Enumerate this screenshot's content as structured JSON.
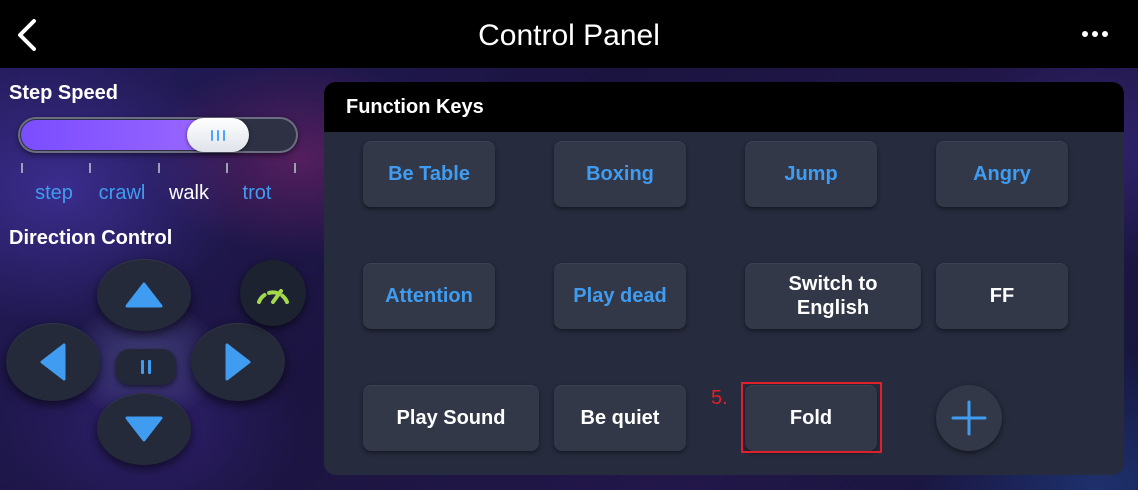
{
  "header": {
    "title": "Control Panel",
    "back_icon": "chevron-left-icon",
    "more_icon": "more-horizontal-icon"
  },
  "step_speed": {
    "label": "Step Speed",
    "options": [
      "step",
      "crawl",
      "walk",
      "trot"
    ],
    "selected": "walk",
    "value_fraction": 0.73
  },
  "direction": {
    "label": "Direction Control",
    "buttons": [
      "up",
      "left",
      "pause",
      "right",
      "down"
    ],
    "gauge_icon": "speedometer-icon"
  },
  "function_keys": {
    "title": "Function Keys",
    "keys": [
      {
        "label": "Be Table",
        "color": "#3f9cf0"
      },
      {
        "label": "Boxing",
        "color": "#3f9cf0"
      },
      {
        "label": "Jump",
        "color": "#3f9cf0"
      },
      {
        "label": "Angry",
        "color": "#3f9cf0"
      },
      {
        "label": "Attention",
        "color": "#3f9cf0"
      },
      {
        "label": "Play dead",
        "color": "#3f9cf0"
      },
      {
        "label": "Switch to English",
        "color": "#ffffff"
      },
      {
        "label": "FF",
        "color": "#ffffff"
      },
      {
        "label": "Play Sound",
        "color": "#ffffff"
      },
      {
        "label": "Be quiet",
        "color": "#ffffff"
      },
      {
        "label": "Fold",
        "color": "#ffffff"
      }
    ],
    "add_icon": "plus-icon"
  },
  "annotation": {
    "number": "5.",
    "color": "#e0202a"
  },
  "colors": {
    "accent_blue": "#3f9cf0",
    "slider_purple": "#8a5cff"
  }
}
